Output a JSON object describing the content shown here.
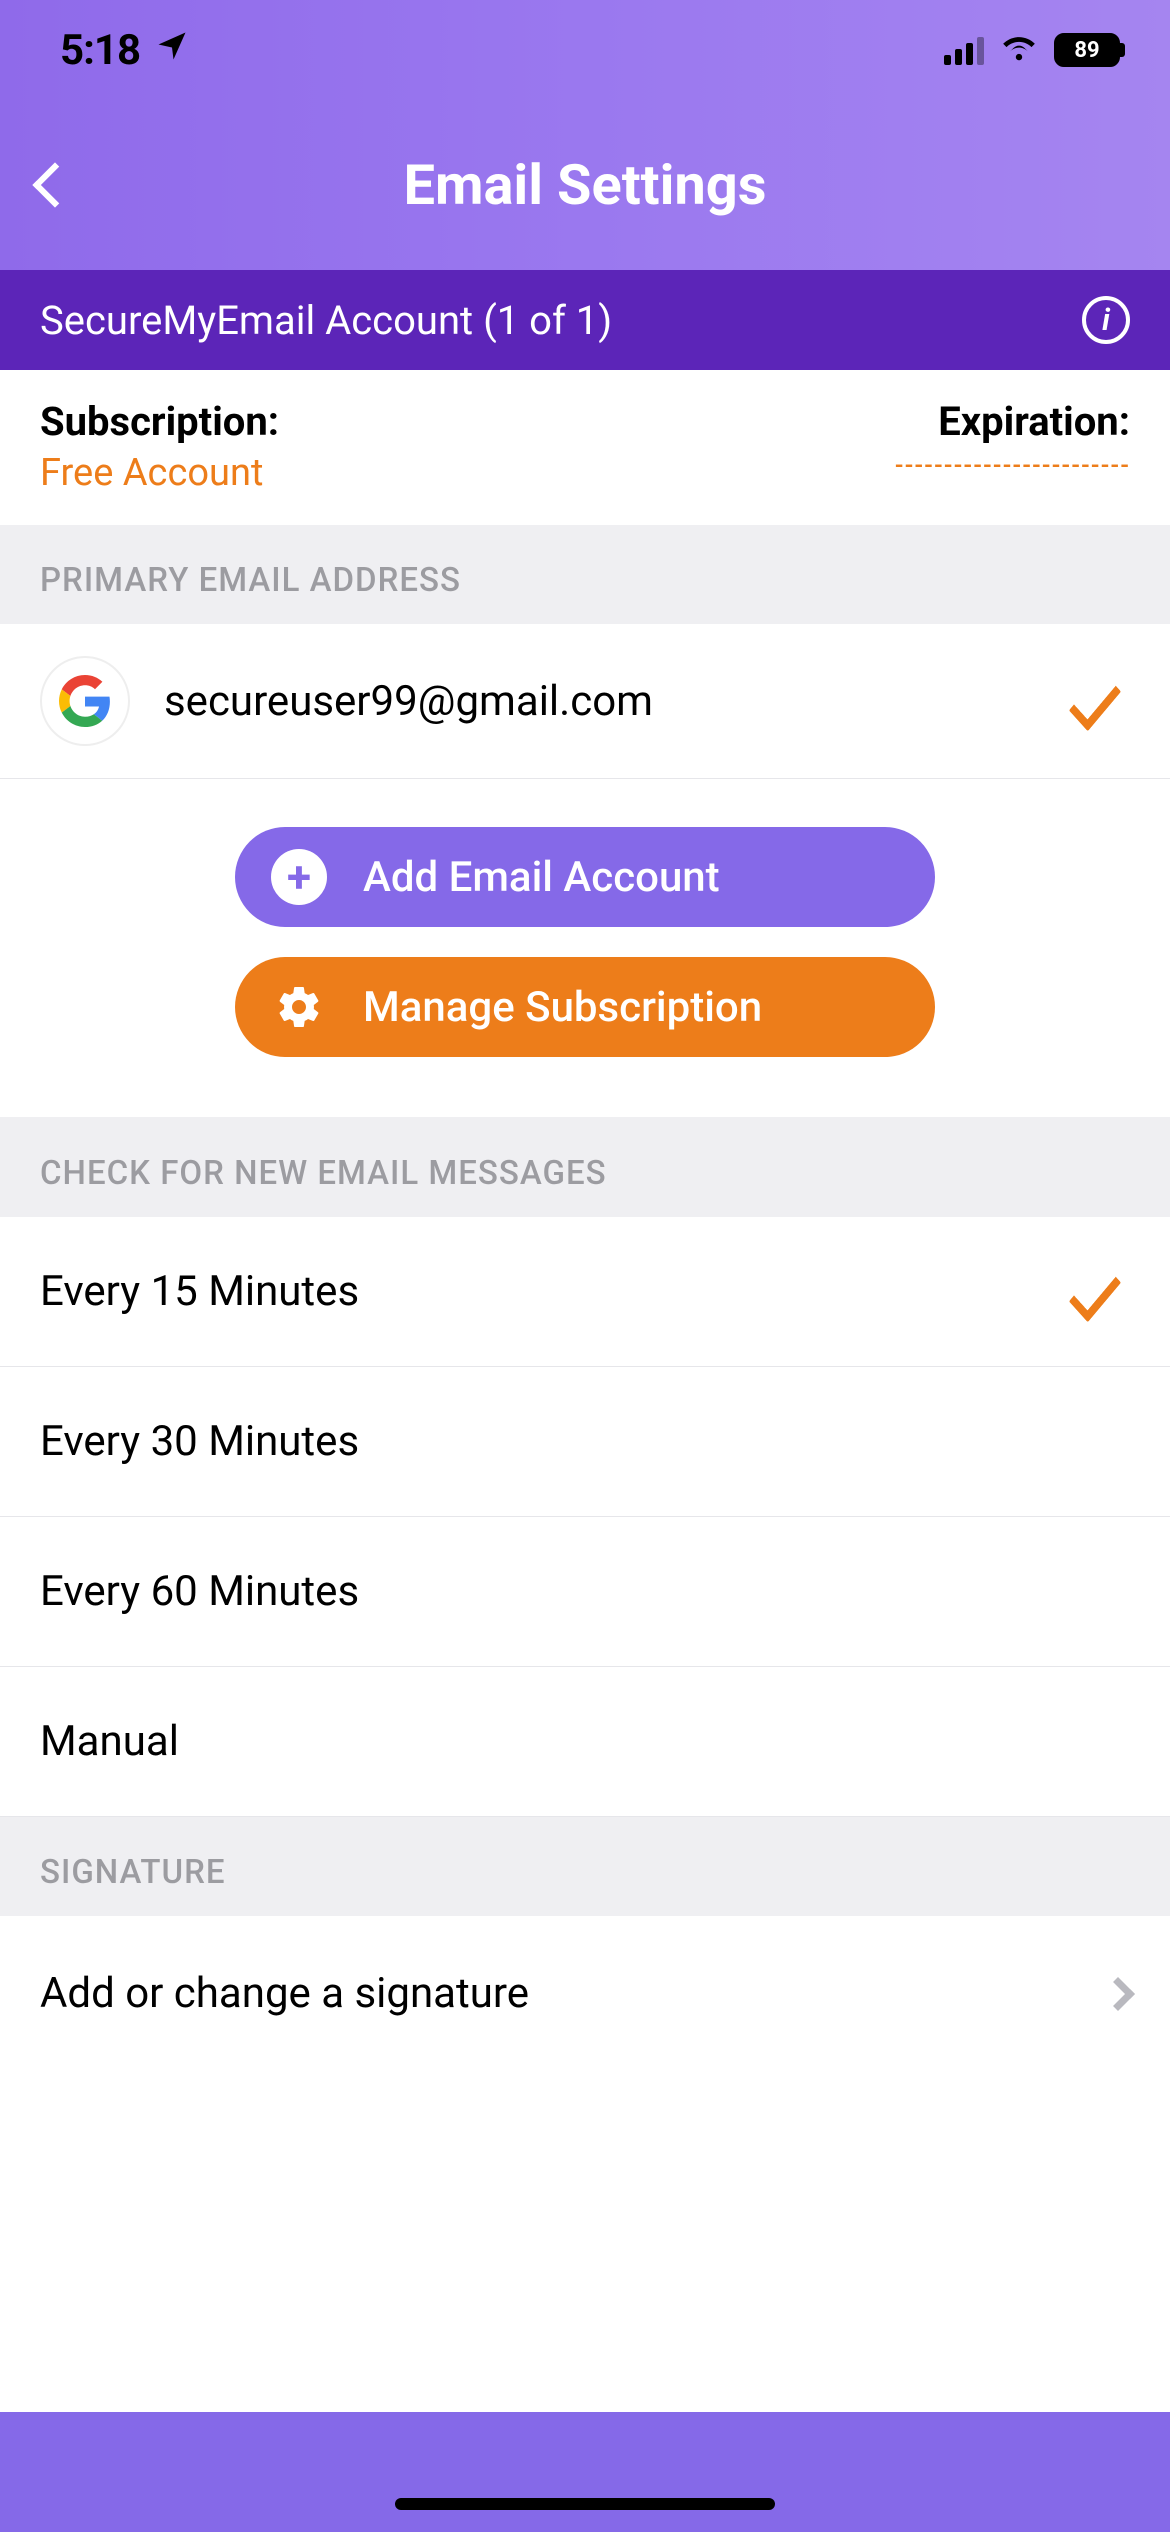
{
  "status": {
    "time": "5:18",
    "battery": "89"
  },
  "nav": {
    "title": "Email Settings"
  },
  "account": {
    "banner": "SecureMyEmail Account (1 of 1)"
  },
  "subscription": {
    "label": "Subscription:",
    "value": "Free Account",
    "expiration_label": "Expiration:",
    "expiration_value": "------------------------"
  },
  "sections": {
    "primary_email": "PRIMARY EMAIL ADDRESS",
    "check_interval": "CHECK FOR NEW EMAIL MESSAGES",
    "signature": "SIGNATURE"
  },
  "primary_email": {
    "address": "secureuser99@gmail.com",
    "provider": "google"
  },
  "buttons": {
    "add_account": "Add Email Account",
    "manage_subscription": "Manage Subscription"
  },
  "intervals": [
    {
      "label": "Every 15 Minutes",
      "selected": true
    },
    {
      "label": "Every 30 Minutes",
      "selected": false
    },
    {
      "label": "Every 60 Minutes",
      "selected": false
    },
    {
      "label": "Manual",
      "selected": false
    }
  ],
  "signature": {
    "row_label": "Add or change a signature"
  },
  "colors": {
    "accent_orange": "#ed7d1a",
    "accent_purple": "#8569e8",
    "banner_purple": "#5c25b8"
  }
}
